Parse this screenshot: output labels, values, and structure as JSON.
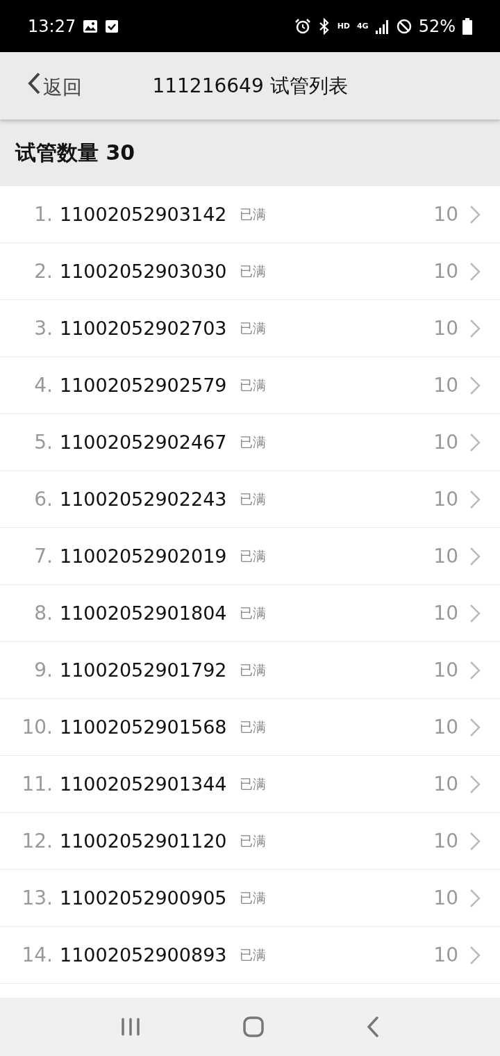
{
  "status_bar": {
    "time": "13:27",
    "network_label": "HD",
    "network_type": "4G",
    "battery": "52%"
  },
  "header": {
    "back": "返回",
    "title": "111216649 试管列表"
  },
  "section": {
    "title": "试管数量 30"
  },
  "tubes": [
    {
      "index": "1.",
      "code": "11002052903142",
      "status": "已满",
      "count": "10"
    },
    {
      "index": "2.",
      "code": "11002052903030",
      "status": "已满",
      "count": "10"
    },
    {
      "index": "3.",
      "code": "11002052902703",
      "status": "已满",
      "count": "10"
    },
    {
      "index": "4.",
      "code": "11002052902579",
      "status": "已满",
      "count": "10"
    },
    {
      "index": "5.",
      "code": "11002052902467",
      "status": "已满",
      "count": "10"
    },
    {
      "index": "6.",
      "code": "11002052902243",
      "status": "已满",
      "count": "10"
    },
    {
      "index": "7.",
      "code": "11002052902019",
      "status": "已满",
      "count": "10"
    },
    {
      "index": "8.",
      "code": "11002052901804",
      "status": "已满",
      "count": "10"
    },
    {
      "index": "9.",
      "code": "11002052901792",
      "status": "已满",
      "count": "10"
    },
    {
      "index": "10.",
      "code": "11002052901568",
      "status": "已满",
      "count": "10"
    },
    {
      "index": "11.",
      "code": "11002052901344",
      "status": "已满",
      "count": "10"
    },
    {
      "index": "12.",
      "code": "11002052901120",
      "status": "已满",
      "count": "10"
    },
    {
      "index": "13.",
      "code": "11002052900905",
      "status": "已满",
      "count": "10"
    },
    {
      "index": "14.",
      "code": "11002052900893",
      "status": "已满",
      "count": "10"
    }
  ]
}
